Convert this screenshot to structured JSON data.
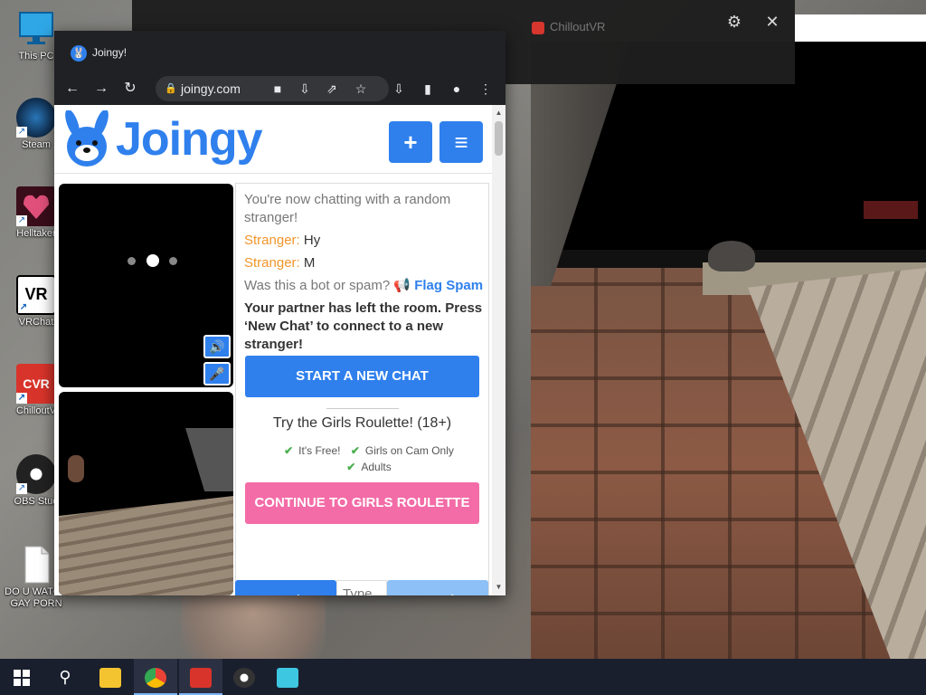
{
  "desktop": {
    "icons": [
      {
        "label": "This PC",
        "icon": "monitor-icon"
      },
      {
        "label": "Steam",
        "icon": "steam-icon"
      },
      {
        "label": "Helltaker",
        "icon": "helltaker-icon"
      },
      {
        "label": "VRChat",
        "icon": "vrchat-icon",
        "badge": "VR"
      },
      {
        "label": "ChilloutV",
        "icon": "chilloutvr-icon",
        "badge": "CVR"
      },
      {
        "label": "OBS Stud",
        "icon": "obs-icon"
      },
      {
        "label": "DO U WATCH GAY PORN",
        "icon": "text-file-icon"
      }
    ]
  },
  "overlay_window": {
    "tab_title": "ChilloutVR",
    "settings_glyph": "⚙",
    "close_glyph": "✕"
  },
  "browser": {
    "tab_title": "Joingy!",
    "url": "joingy.com",
    "nav": {
      "back": "←",
      "forward": "→",
      "reload": "↻",
      "menu": "⋮"
    }
  },
  "page": {
    "logo_text": "Joingy",
    "add_button": "+",
    "menu_button": "≡",
    "chat": {
      "intro": "You're now chatting with a random stranger!",
      "messages": [
        {
          "author": "Stranger:",
          "text": "Hy"
        },
        {
          "author": "Stranger:",
          "text": "M"
        }
      ],
      "spam_prompt": "Was this a bot or spam?",
      "flag_label": "Flag Spam",
      "left_notice": "Your partner has left the room. Press ‘New Chat’ to connect to a new stranger!",
      "start_button": "START A NEW CHAT",
      "promo_title": "Try the Girls Roulette! (18+)",
      "promo_features": [
        "It's Free!",
        "Girls on Cam Only",
        "Adults"
      ],
      "girls_button": "CONTINUE TO GIRLS ROULETTE"
    },
    "input_bar": {
      "new_chat": "New Chat",
      "placeholder": "Type a",
      "send": "Send"
    }
  },
  "taskbar": {
    "items": [
      "start-button",
      "search-icon",
      "file-explorer-icon",
      "chrome-icon",
      "chilloutvr-icon",
      "obs-icon",
      "app-icon"
    ],
    "colors": {
      "background": "#1a1f2e",
      "accent": "#2f80ed",
      "pink": "#f36ca7",
      "orange": "#f2952a"
    }
  }
}
